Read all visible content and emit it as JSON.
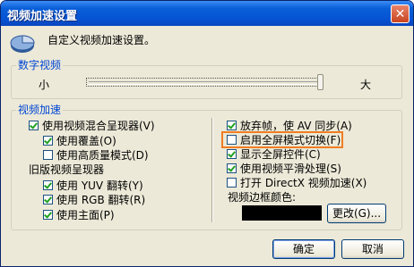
{
  "window": {
    "title": "视频加速设置",
    "close_glyph": "✕"
  },
  "header": {
    "text": "自定义视频加速设置。",
    "icon": "pie-chart-icon"
  },
  "digital_video": {
    "label": "数字视频",
    "slider_min_label": "小",
    "slider_max_label": "大",
    "slider_value": 1.0
  },
  "video_accel": {
    "label": "视频加速",
    "left": {
      "use_mixing_renderer": {
        "label": "使用视频混合呈现器(V)",
        "checked": true
      },
      "use_overlay": {
        "label": "使用覆盖(O)",
        "checked": true
      },
      "use_hq_mode": {
        "label": "使用高质量模式(D)",
        "checked": false
      },
      "legacy_renderer_label": "旧版视频呈现器",
      "yuv_flip": {
        "label": "使用 YUV 翻转(Y)",
        "checked": true
      },
      "rgb_flip": {
        "label": "使用 RGB 翻转(R)",
        "checked": true
      },
      "use_main_surface": {
        "label": "使用主面(P)",
        "checked": true
      }
    },
    "right": {
      "drop_frames": {
        "label": "放弃帧，使 AV 同步(A)",
        "checked": true
      },
      "fullscreen_switch": {
        "label": "启用全屏模式切换(F)",
        "checked": false
      },
      "fullscreen_controls": {
        "label": "显示全屏控件(C)",
        "checked": true
      },
      "smooth_video": {
        "label": "使用视频平滑处理(S)",
        "checked": true
      },
      "directx_accel": {
        "label": "打开 DirectX 视频加速(X)",
        "checked": false
      },
      "border_color_label": "视频边框颜色:",
      "border_color_value": "#000000",
      "change_button": "更改(G)..."
    }
  },
  "buttons": {
    "ok": "确定",
    "cancel": "取消"
  }
}
